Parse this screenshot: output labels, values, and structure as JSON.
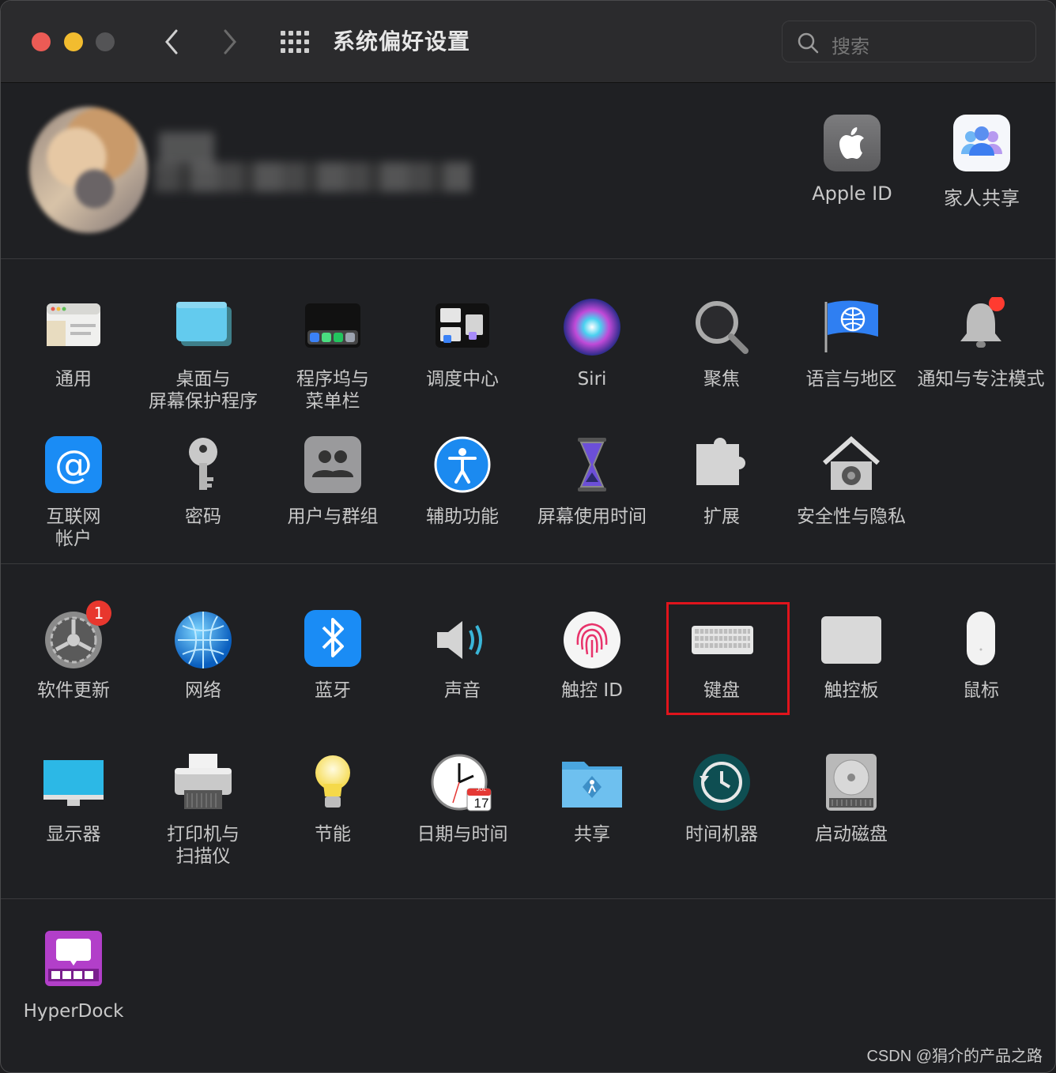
{
  "window": {
    "title": "系统偏好设置",
    "search_placeholder": "搜索"
  },
  "user": {
    "apple_id_label": "Apple ID",
    "family_label": "家人共享"
  },
  "section1": [
    {
      "id": "general",
      "label": "通用"
    },
    {
      "id": "desktop",
      "label": "桌面与\n屏幕保护程序"
    },
    {
      "id": "dock",
      "label": "程序坞与\n菜单栏"
    },
    {
      "id": "mission",
      "label": "调度中心"
    },
    {
      "id": "siri",
      "label": "Siri"
    },
    {
      "id": "spotlight",
      "label": "聚焦"
    },
    {
      "id": "language",
      "label": "语言与地区"
    },
    {
      "id": "notifications",
      "label": "通知与专注模式"
    },
    {
      "id": "internet",
      "label": "互联网\n帐户"
    },
    {
      "id": "passwords",
      "label": "密码"
    },
    {
      "id": "users",
      "label": "用户与群组"
    },
    {
      "id": "accessibility",
      "label": "辅助功能"
    },
    {
      "id": "screentime",
      "label": "屏幕使用时间"
    },
    {
      "id": "extensions",
      "label": "扩展"
    },
    {
      "id": "security",
      "label": "安全性与隐私"
    }
  ],
  "section2": [
    {
      "id": "update",
      "label": "软件更新",
      "badge": "1"
    },
    {
      "id": "network",
      "label": "网络"
    },
    {
      "id": "bluetooth",
      "label": "蓝牙"
    },
    {
      "id": "sound",
      "label": "声音"
    },
    {
      "id": "touchid",
      "label": "触控 ID"
    },
    {
      "id": "keyboard",
      "label": "键盘"
    },
    {
      "id": "trackpad",
      "label": "触控板"
    },
    {
      "id": "mouse",
      "label": "鼠标"
    },
    {
      "id": "displays",
      "label": "显示器"
    },
    {
      "id": "printers",
      "label": "打印机与\n扫描仪"
    },
    {
      "id": "battery",
      "label": "节能"
    },
    {
      "id": "datetime",
      "label": "日期与时间",
      "calendar_month": "JUL",
      "calendar_day": "17"
    },
    {
      "id": "sharing",
      "label": "共享"
    },
    {
      "id": "timemachine",
      "label": "时间机器"
    },
    {
      "id": "startup",
      "label": "启动磁盘"
    }
  ],
  "section3": [
    {
      "id": "hyperdock",
      "label": "HyperDock"
    }
  ],
  "watermark": "CSDN @狷介的产品之路",
  "colors": {
    "highlight": "#e0141c",
    "badge": "#e8372e",
    "close": "#ec5b55",
    "minimize": "#f2bc2f"
  }
}
